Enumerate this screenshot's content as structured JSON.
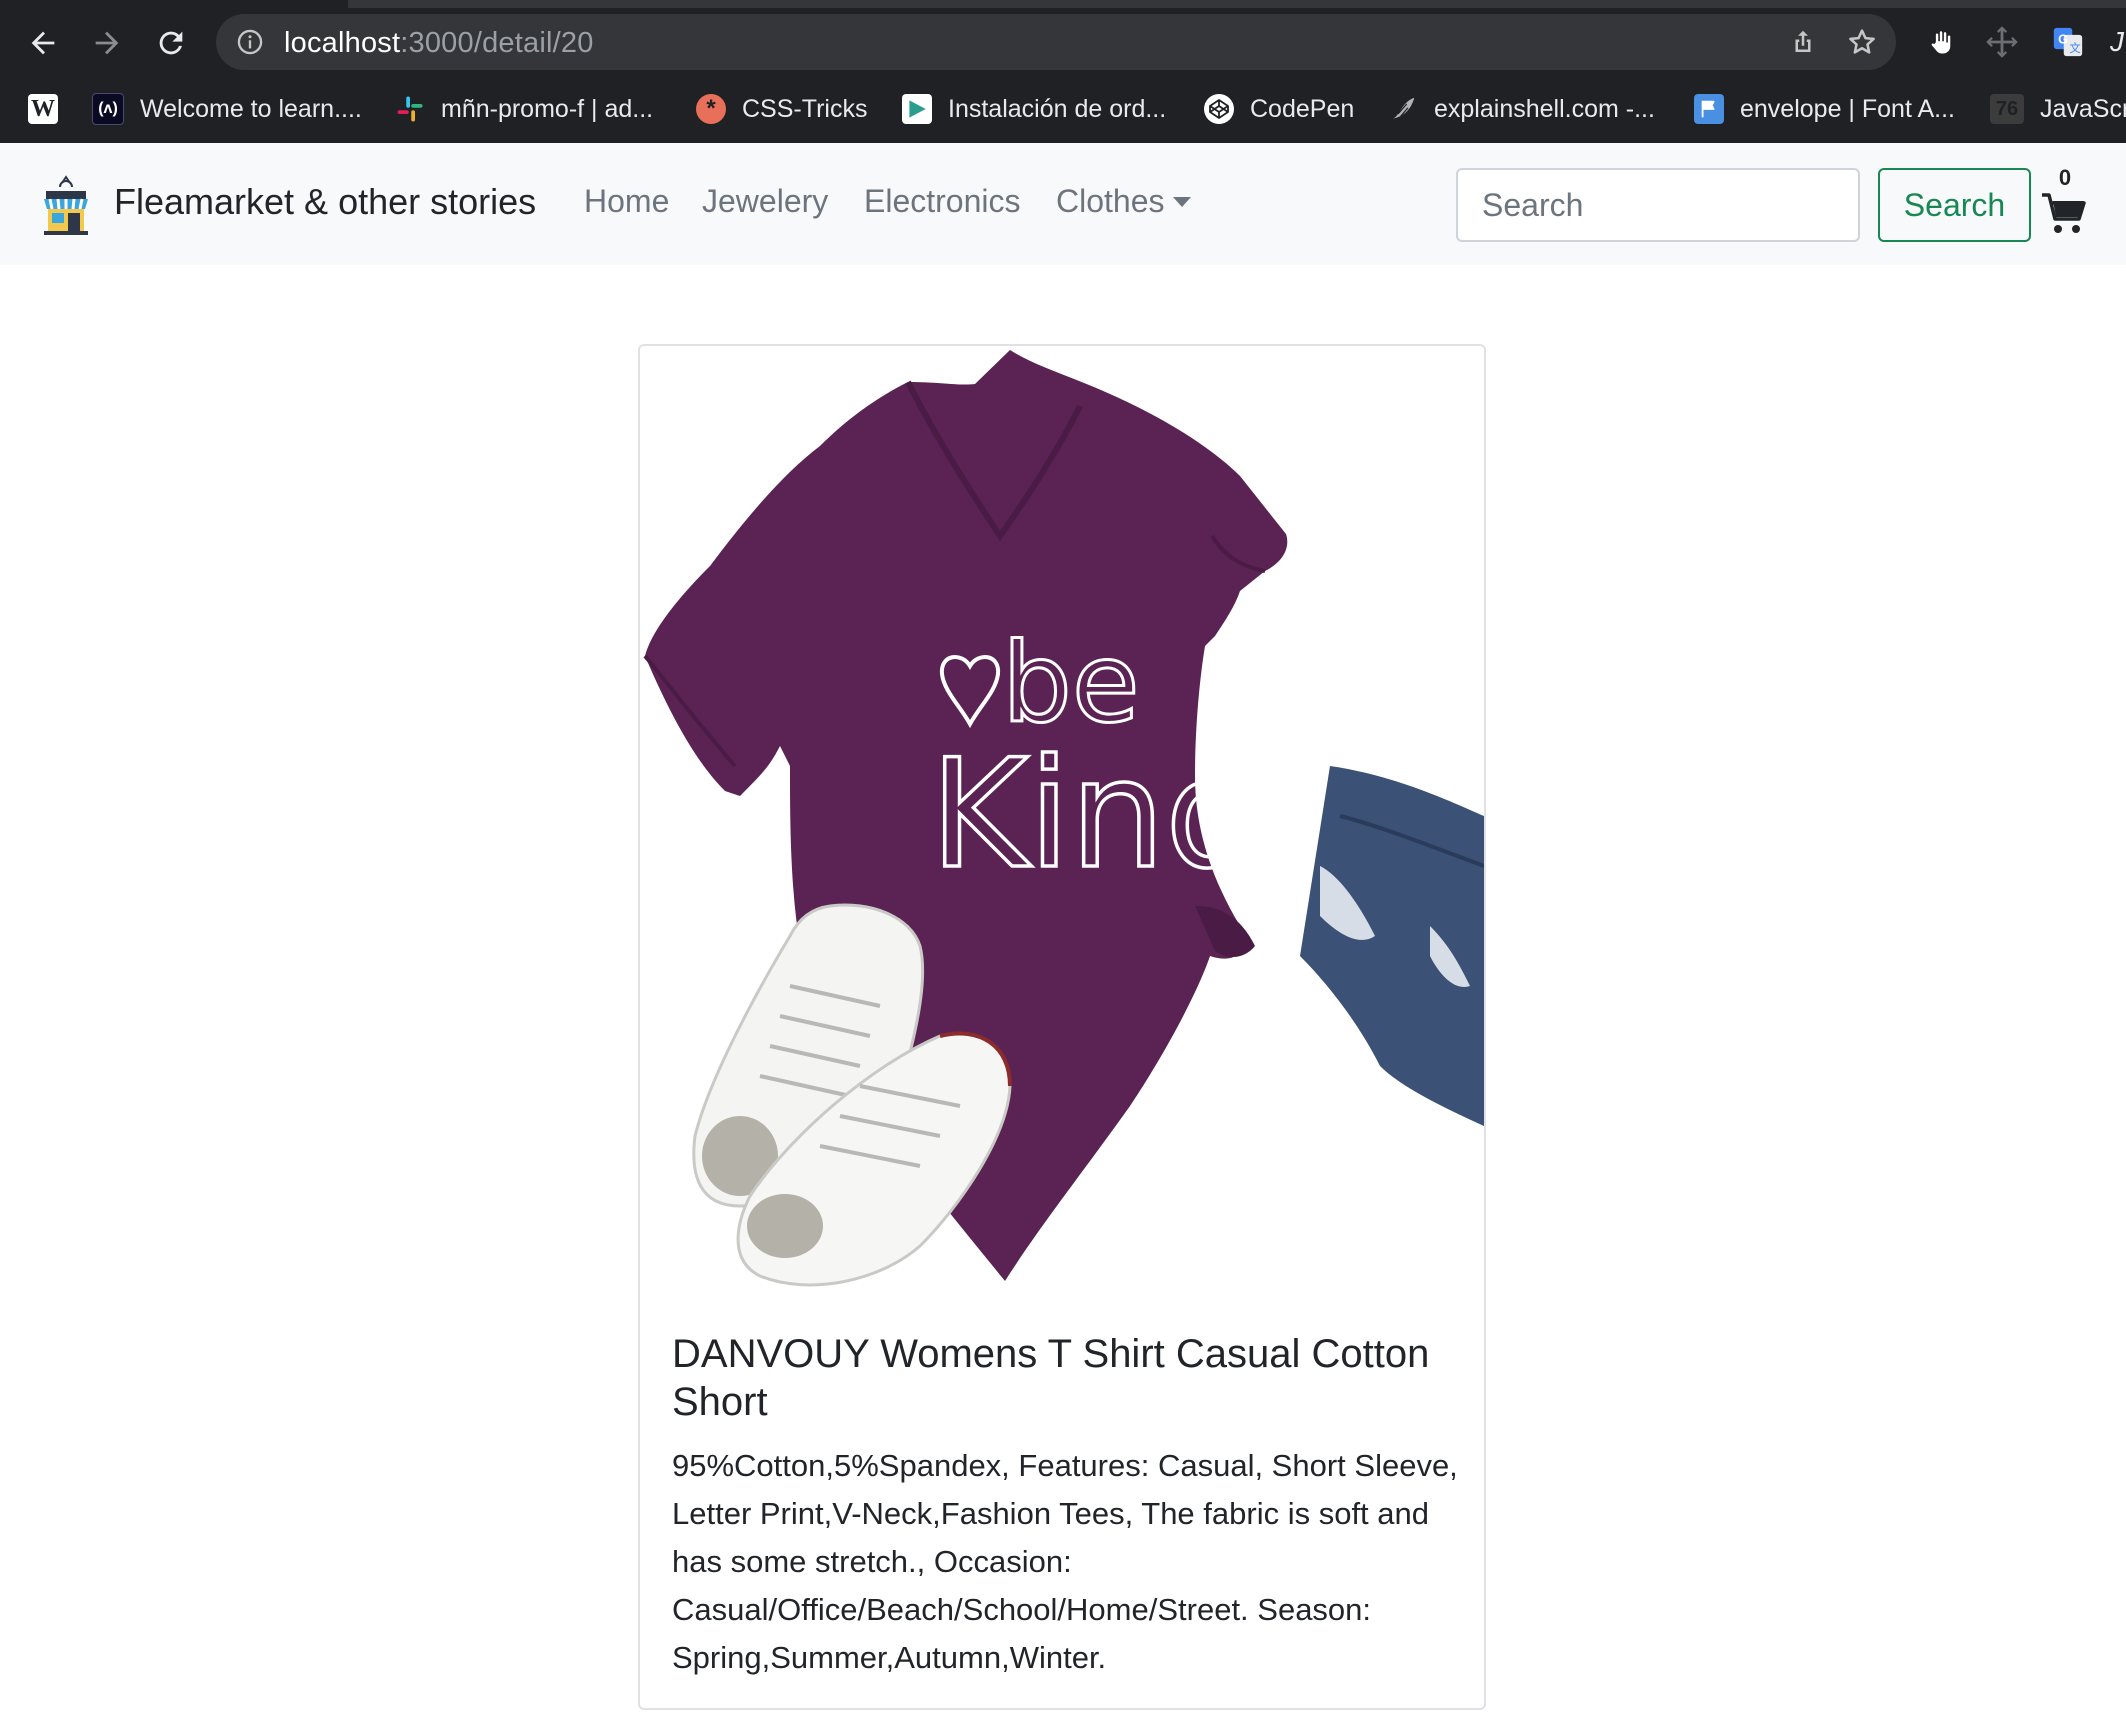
{
  "browser": {
    "url_host": "localhost",
    "url_path": ":3000/detail/20",
    "bookmarks": [
      {
        "label": "",
        "icon": "wikipedia-icon"
      },
      {
        "label": "Welcome to learn....",
        "icon": "freecodecamp-icon"
      },
      {
        "label": "mñn-promo-f | ad...",
        "icon": "slack-icon"
      },
      {
        "label": "CSS-Tricks",
        "icon": "css-tricks-icon"
      },
      {
        "label": "Instalación de ord...",
        "icon": "play-icon"
      },
      {
        "label": "CodePen",
        "icon": "codepen-icon"
      },
      {
        "label": "explainshell.com -...",
        "icon": "shell-icon"
      },
      {
        "label": "envelope | Font A...",
        "icon": "flag-icon"
      },
      {
        "label": "JavaScr",
        "icon": "number-icon",
        "icon_text": "76"
      }
    ]
  },
  "navbar": {
    "brand": "Fleamarket & other stories",
    "links": [
      "Home",
      "Jewelery",
      "Electronics",
      "Clothes"
    ],
    "search_placeholder": "Search",
    "search_button": "Search",
    "cart_count": "0"
  },
  "product": {
    "title": "DANVOUY Womens T Shirt Casual Cotton Short",
    "description": "95%Cotton,5%Spandex, Features: Casual, Short Sleeve, Letter Print,V-Neck,Fashion Tees, The fabric is soft and has some stretch., Occasion: Casual/Office/Beach/School/Home/Street. Season: Spring,Summer,Autumn,Winter.",
    "image_print": [
      "be",
      "Kind"
    ]
  },
  "colors": {
    "accent": "#198754",
    "shirt": "#5a2353",
    "navbar_bg": "#f8f9fa",
    "chrome_bg": "#202124"
  }
}
